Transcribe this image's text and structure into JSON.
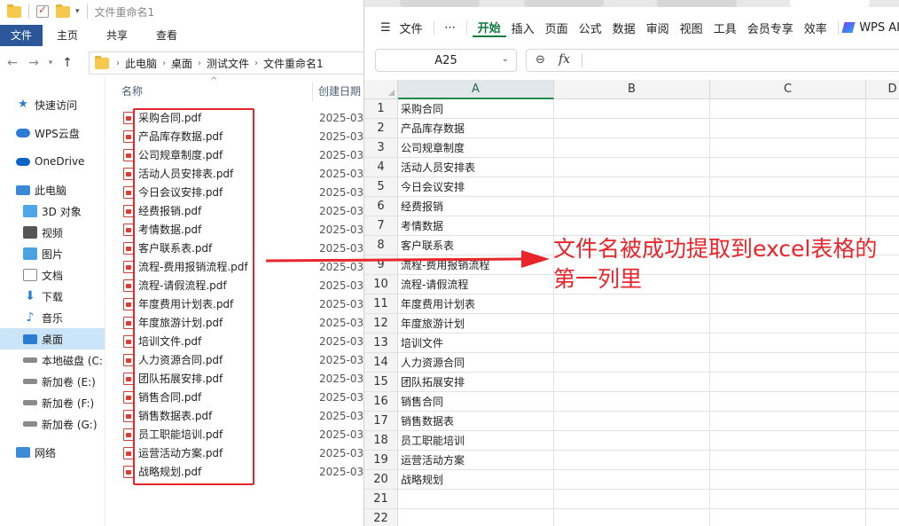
{
  "explorer": {
    "window_title": "文件重命名1",
    "ribbon_tabs": [
      "文件",
      "主页",
      "共享",
      "查看"
    ],
    "breadcrumb": [
      "此电脑",
      "桌面",
      "测试文件",
      "文件重命名1"
    ],
    "nav_items": [
      {
        "label": "快速访问",
        "icon": "star-icon"
      },
      {
        "label": "WPS云盘",
        "icon": "cloud-icon"
      },
      {
        "label": "OneDrive",
        "icon": "onedrive-icon"
      },
      {
        "label": "此电脑",
        "icon": "pc-icon"
      },
      {
        "label": "3D 对象",
        "icon": "cube-icon"
      },
      {
        "label": "视频",
        "icon": "video-icon"
      },
      {
        "label": "图片",
        "icon": "picture-icon"
      },
      {
        "label": "文档",
        "icon": "document-icon"
      },
      {
        "label": "下载",
        "icon": "download-icon"
      },
      {
        "label": "音乐",
        "icon": "music-icon"
      },
      {
        "label": "桌面",
        "icon": "desktop-icon"
      },
      {
        "label": "本地磁盘 (C:",
        "icon": "disk-icon"
      },
      {
        "label": "新加卷 (E:)",
        "icon": "disk-icon"
      },
      {
        "label": "新加卷 (F:)",
        "icon": "disk-icon"
      },
      {
        "label": "新加卷 (G:)",
        "icon": "disk-icon"
      },
      {
        "label": "网络",
        "icon": "network-icon"
      }
    ],
    "selected_nav": "桌面",
    "columns": {
      "name": "名称",
      "created": "创建日期"
    },
    "files": [
      {
        "name": "采购合同.pdf",
        "date": "2025-03-"
      },
      {
        "name": "产品库存数据.pdf",
        "date": "2025-03-"
      },
      {
        "name": "公司规章制度.pdf",
        "date": "2025-03-"
      },
      {
        "name": "活动人员安排表.pdf",
        "date": "2025-03-"
      },
      {
        "name": "今日会议安排.pdf",
        "date": "2025-03-"
      },
      {
        "name": "经费报销.pdf",
        "date": "2025-03-"
      },
      {
        "name": "考情数据.pdf",
        "date": "2025-03-"
      },
      {
        "name": "客户联系表.pdf",
        "date": "2025-03-"
      },
      {
        "name": "流程-费用报销流程.pdf",
        "date": "2025-03-"
      },
      {
        "name": "流程-请假流程.pdf",
        "date": "2025-03-"
      },
      {
        "name": "年度费用计划表.pdf",
        "date": "2025-03-"
      },
      {
        "name": "年度旅游计划.pdf",
        "date": "2025-03-"
      },
      {
        "name": "培训文件.pdf",
        "date": "2025-03-"
      },
      {
        "name": "人力资源合同.pdf",
        "date": "2025-03-"
      },
      {
        "name": "团队拓展安排.pdf",
        "date": "2025-03-"
      },
      {
        "name": "销售合同.pdf",
        "date": "2025-03-"
      },
      {
        "name": "销售数据表.pdf",
        "date": "2025-03-"
      },
      {
        "name": "员工职能培训.pdf",
        "date": "2025-03-"
      },
      {
        "name": "运营活动方案.pdf",
        "date": "2025-03-"
      },
      {
        "name": "战略规划.pdf",
        "date": "2025-03-"
      }
    ]
  },
  "excel": {
    "menu_items": [
      "文件",
      "⋯",
      "开始",
      "插入",
      "页面",
      "公式",
      "数据",
      "审阅",
      "视图",
      "工具",
      "会员专享",
      "效率"
    ],
    "active_menu": "开始",
    "ai_label": "WPS AI",
    "name_box": "A25",
    "fx_label": "fx",
    "columns": [
      "A",
      "B",
      "C",
      "D"
    ],
    "rows": [
      "1",
      "2",
      "3",
      "4",
      "5",
      "6",
      "7",
      "8",
      "9",
      "10",
      "11",
      "12",
      "13",
      "14",
      "15",
      "16",
      "17",
      "18",
      "19",
      "20",
      "21",
      "22"
    ],
    "cells_a": [
      "采购合同",
      "产品库存数据",
      "公司规章制度",
      "活动人员安排表",
      "今日会议安排",
      "经费报销",
      "考情数据",
      "客户联系表",
      "流程-费用报销流程",
      "流程-请假流程",
      "年度费用计划表",
      "年度旅游计划",
      "培训文件",
      "人力资源合同",
      "团队拓展安排",
      "销售合同",
      "销售数据表",
      "员工职能培训",
      "运营活动方案",
      "战略规划",
      "",
      ""
    ]
  },
  "annotation": {
    "text": "文件名被成功提取到excel表格的第一列里",
    "color": "#e8252a"
  }
}
